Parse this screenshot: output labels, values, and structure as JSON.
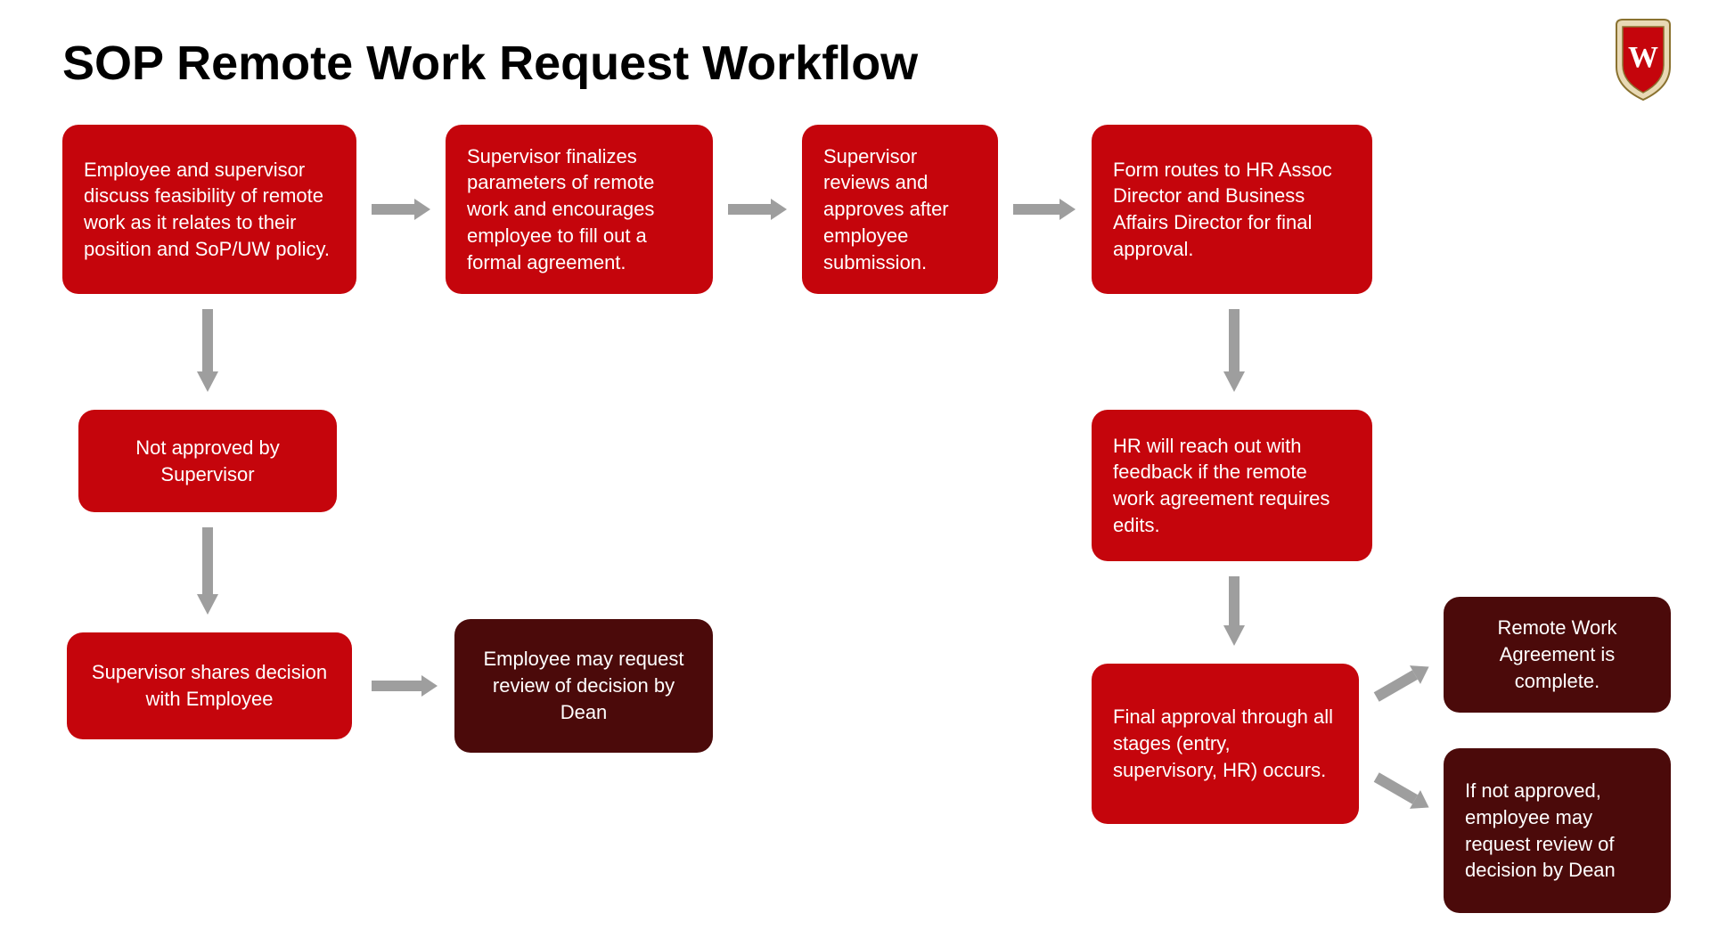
{
  "title": "SOP Remote Work Request Workflow",
  "boxes": {
    "b1": "Employee and supervisor discuss feasibility of remote work as it relates to their position and SoP/UW policy.",
    "b2": "Supervisor finalizes parameters of remote work and encourages employee to fill out a formal agreement.",
    "b3": "Supervisor reviews and approves after employee submission.",
    "b4": "Form routes to HR Assoc Director and Business Affairs Director for final approval.",
    "b5": "Not approved by Supervisor",
    "b6": "Supervisor shares decision with Employee",
    "b7": "Employee may request review of decision by Dean",
    "b8": "HR will reach out with feedback if the remote work agreement requires edits.",
    "b9": "Final approval through all stages (entry, supervisory, HR) occurs.",
    "b10": "Remote Work Agreement is complete.",
    "b11": "If not approved, employee may request review of decision by Dean"
  },
  "logo_letter": "W"
}
